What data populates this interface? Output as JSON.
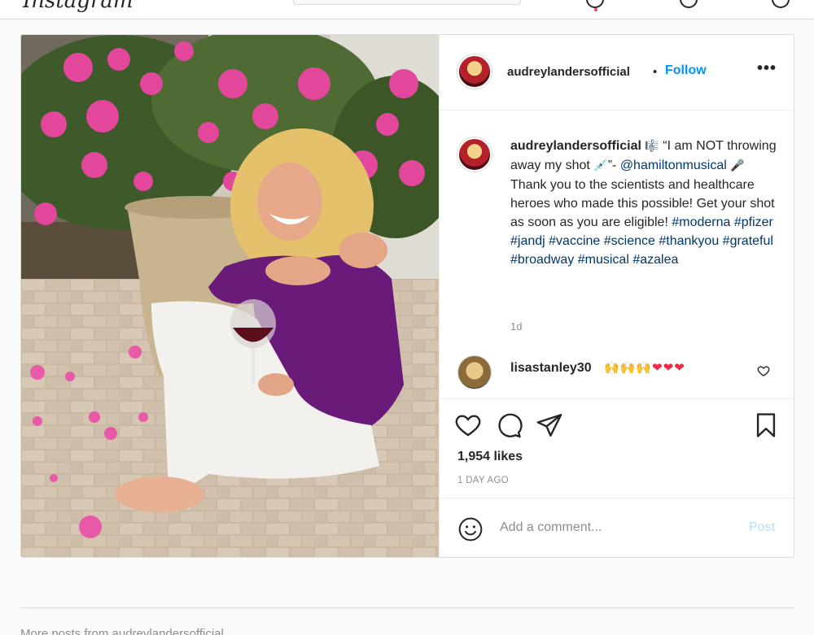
{
  "header": {
    "logo_text": "Instagram"
  },
  "post": {
    "username": "audreylandersofficial",
    "separator": "•",
    "follow_label": "Follow",
    "more_label": "•••",
    "caption": {
      "username": "audreylandersofficial",
      "music_emoji": "🎼",
      "part1": " “I am NOT throwing away my shot ",
      "syringe_emoji": "💉",
      "part2": "”- ",
      "mention": "@hamiltonmusical",
      "mic_emoji": "🎤",
      "part3": "Thank you to the scientists and healthcare heroes who made this possible! Get your shot as soon as you are eligible! ",
      "hashtags": [
        "#moderna",
        "#pfizer",
        "#jandj",
        "#vaccine",
        "#science",
        "#thankyou",
        "#grateful",
        "#broadway",
        "#musical",
        "#azalea"
      ]
    },
    "caption_time": "1d",
    "comment": {
      "username": "lisastanley30",
      "text": "🙌🙌🙌❤❤❤"
    },
    "likes": "1,954 likes",
    "time_ago": "1 DAY AGO",
    "add_comment_placeholder": "Add a comment...",
    "post_button": "Post",
    "icons": {
      "like": "heart-icon",
      "comment": "comment-icon",
      "share": "paper-plane-icon",
      "save": "bookmark-icon",
      "emoji": "smile-icon"
    }
  },
  "footer": {
    "more_posts_text": "More posts from audreylandersofficial"
  }
}
